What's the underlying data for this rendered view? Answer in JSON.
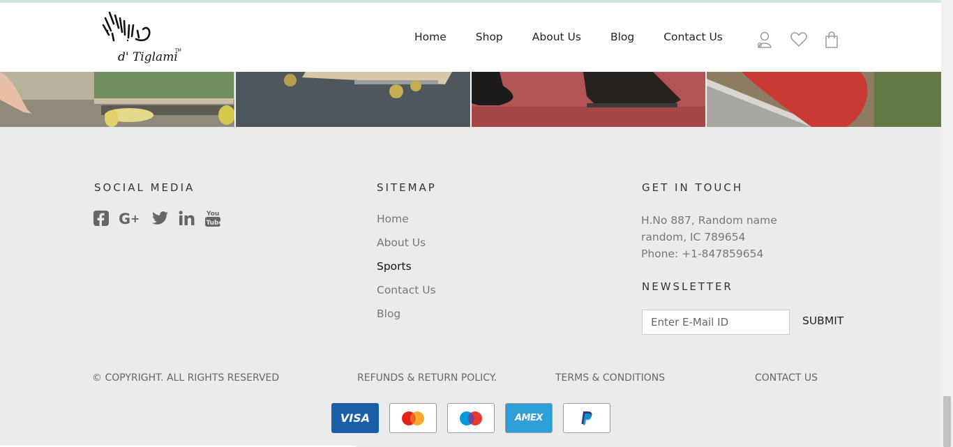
{
  "header": {
    "logo_text": "d' Tiglami",
    "logo_tm": "TM",
    "nav": [
      "Home",
      "Shop",
      "About Us",
      "Blog",
      "Contact Us"
    ],
    "icons": [
      "user-icon",
      "heart-icon",
      "shopping-bag-icon"
    ]
  },
  "banner": {
    "tiles": [
      "skateboard-hand",
      "skateboard-wheels",
      "black-boots",
      "red-sneaker"
    ]
  },
  "footer": {
    "social": {
      "title": "SOCIAL MEDIA",
      "icons": [
        "facebook-icon",
        "google-plus-icon",
        "twitter-icon",
        "linkedin-icon",
        "youtube-icon"
      ]
    },
    "sitemap": {
      "title": "SITEMAP",
      "items": [
        "Home",
        "About Us",
        "Sports",
        "Contact Us",
        "Blog"
      ],
      "active": "Sports"
    },
    "contact": {
      "title": "GET IN TOUCH",
      "address_line1": "H.No 887, Random name",
      "address_line2": "random, IC 789654",
      "phone": "Phone: +1-847859654"
    },
    "newsletter": {
      "title": "NEWSLETTER",
      "placeholder": "Enter E-Mail ID",
      "value": "",
      "submit_label": "SUBMIT"
    },
    "bottom_links": {
      "copyright": "© COPYRIGHT. ALL RIGHTS RESERVED",
      "refunds": "REFUNDS & RETURN POLICY.",
      "terms": "TERMS & CONDITIONS",
      "contact": "CONTACT US"
    },
    "payments": [
      "VISA",
      "mastercard",
      "maestro",
      "AMEX",
      "PayPal"
    ]
  },
  "colors": {
    "footer_bg": "#ebebeb",
    "visa_blue": "#1a5fa8",
    "amex_blue": "#2e9fd8",
    "mc_red": "#e2231a",
    "mc_yellow": "#f9a11b",
    "maestro_blue": "#0099df",
    "paypal_blue": "#253b80"
  }
}
